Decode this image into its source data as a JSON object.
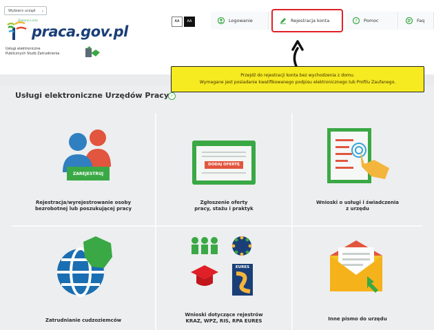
{
  "header": {
    "office_select": "Wybierz urząd",
    "logo_text": "praca.gov.pl",
    "logo_small": "Zielona Linia",
    "services_line1": "Usługi elektroniczne",
    "services_line2": "Publicznych Służb Zatrudnienia",
    "font_small": "AA",
    "font_large": "AA",
    "nav": [
      {
        "label": "Logowanie",
        "icon": "login-icon"
      },
      {
        "label": "Rejestracja konta",
        "icon": "pencil-icon"
      },
      {
        "label": "Pomoc",
        "icon": "help-icon"
      },
      {
        "label": "Faq",
        "icon": "faq-icon"
      }
    ]
  },
  "tooltip": {
    "line1": "Przejdź do rejestracji konta bez wychodzenia z domu.",
    "line2": "Wymagane jest posiadanie kwalifikowanego podpisu elektronicznego lub Profilu Zaufanego."
  },
  "main": {
    "title": "Usługi elektroniczne Urzędów Pracy",
    "tiles": [
      {
        "line1": "Rejestracja/wyrejestrowanie osoby",
        "line2": "bezrobotnej lub poszukującej pracy",
        "button": "ZAREJESTRUJ"
      },
      {
        "line1": "Zgłoszenie oferty",
        "line2": "pracy, stażu i praktyk",
        "button": "DODAJ OFERTĘ"
      },
      {
        "line1": "Wnioski o usługi i świadczenia",
        "line2": "z urzędu"
      },
      {
        "line1": "Zatrudnianie cudzoziemców",
        "line2": ""
      },
      {
        "line1": "Wnioski dotyczące rejestrów",
        "line2": "KRAZ, WPZ, RIS, RPA EURES",
        "badge": "EURES"
      },
      {
        "line1": "Inne pismo do urzędu",
        "line2": ""
      }
    ]
  },
  "colors": {
    "brand_blue": "#1a3f78",
    "brand_green": "#3aa845",
    "tooltip_yellow": "#f6ea21",
    "active_red": "#e01f26"
  }
}
